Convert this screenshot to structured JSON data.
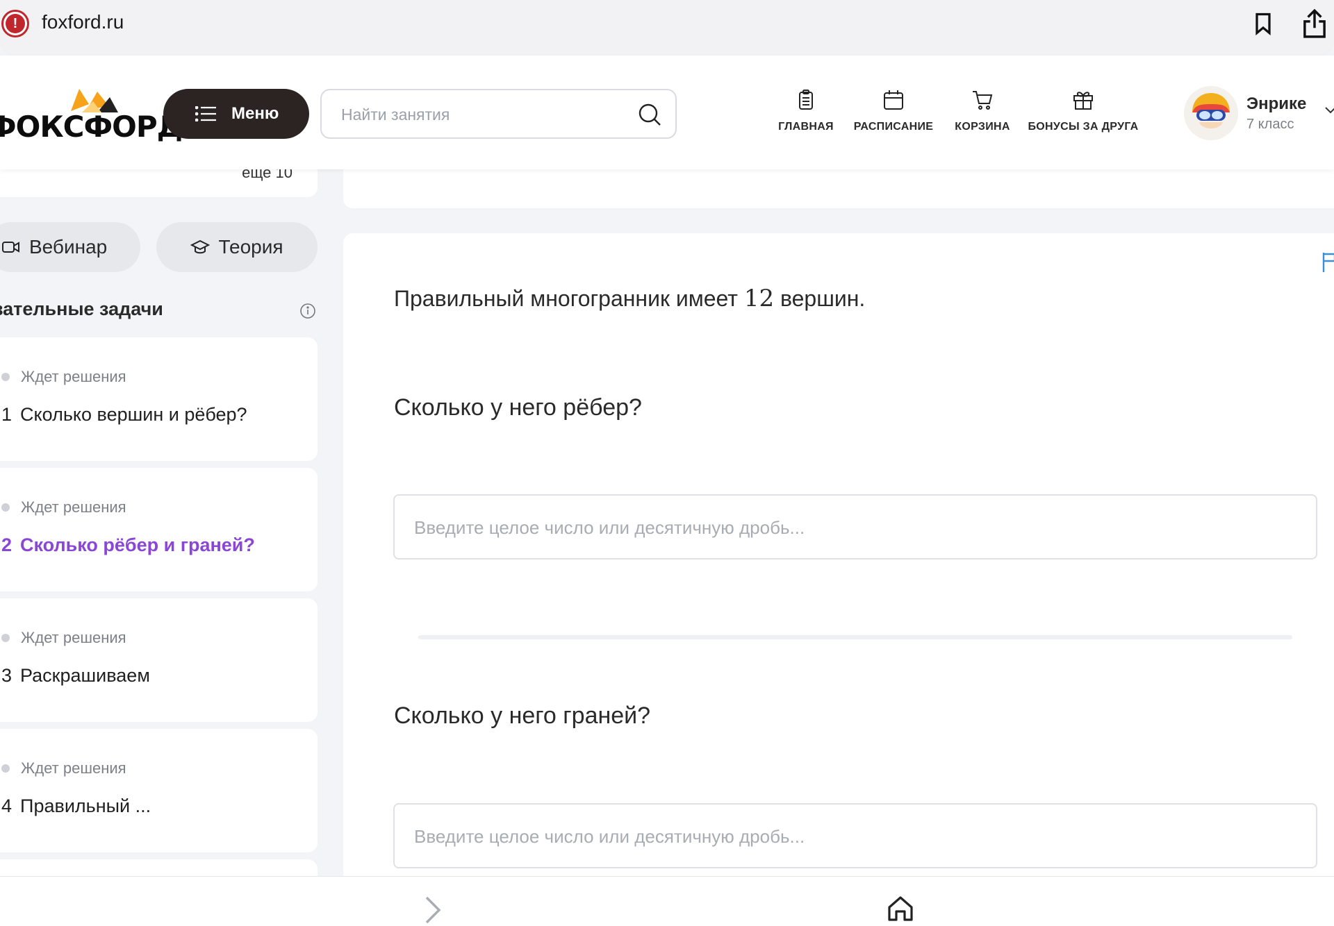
{
  "browser": {
    "domain": "foxford.ru",
    "warning_glyph": "!"
  },
  "header": {
    "logo_text": "ФОКСФОРД",
    "menu_label": "Меню",
    "search_placeholder": "Найти занятия",
    "nav": [
      {
        "label": "ГЛАВНАЯ",
        "icon": "clipboard-icon"
      },
      {
        "label": "РАСПИСАНИЕ",
        "icon": "calendar-icon"
      },
      {
        "label": "КОРЗИНА",
        "icon": "cart-icon"
      },
      {
        "label": "БОНУСЫ ЗА ДРУГА",
        "icon": "gift-icon"
      }
    ],
    "user": {
      "name": "Энрике",
      "grade": "7 класс"
    }
  },
  "sidebar": {
    "more_link": "еще 10",
    "webinar_label": "Вебинар",
    "theory_label": "Теория",
    "section_title": "Обязательные задачи",
    "tasks": [
      {
        "number": "1",
        "title": "Сколько вершин и рёбер?",
        "status": "Ждет решения",
        "active": false
      },
      {
        "number": "2",
        "title": "Сколько рёбер и граней?",
        "status": "Ждет решения",
        "active": true
      },
      {
        "number": "3",
        "title": "Раскрашиваем",
        "status": "Ждет решения",
        "active": false
      },
      {
        "number": "4",
        "title": "Правильный ...",
        "status": "Ждет решения",
        "active": false
      }
    ]
  },
  "problem": {
    "statement_before": "Правильный многогранник имеет ",
    "statement_number": "12",
    "statement_after": " вершин.",
    "question_1": "Сколько у него рёбер?",
    "question_2": "Сколько у него граней?",
    "answer_placeholder": "Введите целое число или десятичную дробь..."
  },
  "colors": {
    "accent_purple": "#8a47d6",
    "menu_dark": "#2b2422",
    "warning_red": "#c0272d",
    "flag_blue": "#3b8fd6"
  }
}
